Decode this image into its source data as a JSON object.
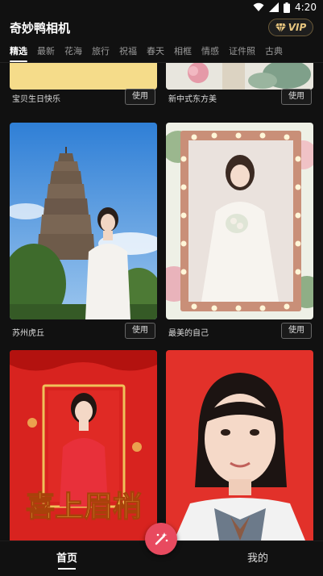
{
  "status": {
    "time": "4:20"
  },
  "app": {
    "title": "奇妙鸭相机",
    "vip_label": "VIP"
  },
  "tabs": [
    {
      "label": "精选",
      "active": true
    },
    {
      "label": "最新"
    },
    {
      "label": "花海"
    },
    {
      "label": "旅行"
    },
    {
      "label": "祝福"
    },
    {
      "label": "春天"
    },
    {
      "label": "相框"
    },
    {
      "label": "情感"
    },
    {
      "label": "证件照"
    },
    {
      "label": "古典"
    }
  ],
  "cards": [
    {
      "caption": "宝贝生日快乐",
      "button": "使用"
    },
    {
      "caption": "新中式东方美",
      "button": "使用"
    },
    {
      "caption": "苏州虎丘",
      "button": "使用"
    },
    {
      "caption": "最美的自己",
      "button": "使用"
    },
    {
      "caption": "",
      "button": ""
    },
    {
      "caption": "",
      "button": ""
    }
  ],
  "card3_banner": "喜上眉梢",
  "bottom_nav": {
    "home": "首页",
    "mine": "我的"
  },
  "colors": {
    "accent": "#e84a5f",
    "vip_gold": "#e7c57e"
  }
}
